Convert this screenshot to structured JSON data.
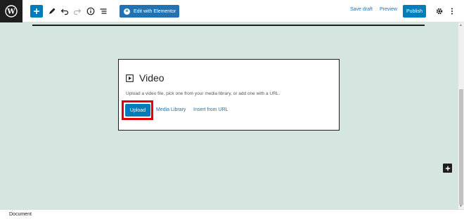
{
  "toolbar": {
    "elementor_label": "Edit with Elementor",
    "save_draft_label": "Save draft",
    "preview_label": "Preview",
    "publish_label": "Publish",
    "icons": [
      "wordpress-logo",
      "plus-icon",
      "pencil-icon",
      "undo-icon",
      "redo-icon",
      "info-icon",
      "list-view-icon",
      "gear-icon",
      "more-vertical-icon"
    ]
  },
  "video_block": {
    "title": "Video",
    "description": "Upload a video file, pick one from your media library, or add one with a URL.",
    "upload_label": "Upload",
    "media_library_label": "Media Library",
    "insert_url_label": "Insert from URL"
  },
  "footer": {
    "breadcrumb": "Document"
  },
  "colors": {
    "canvas_bg": "#d5e5df",
    "accent": "#007cba",
    "highlight": "#e3000f",
    "dark": "#1e1e1e"
  }
}
